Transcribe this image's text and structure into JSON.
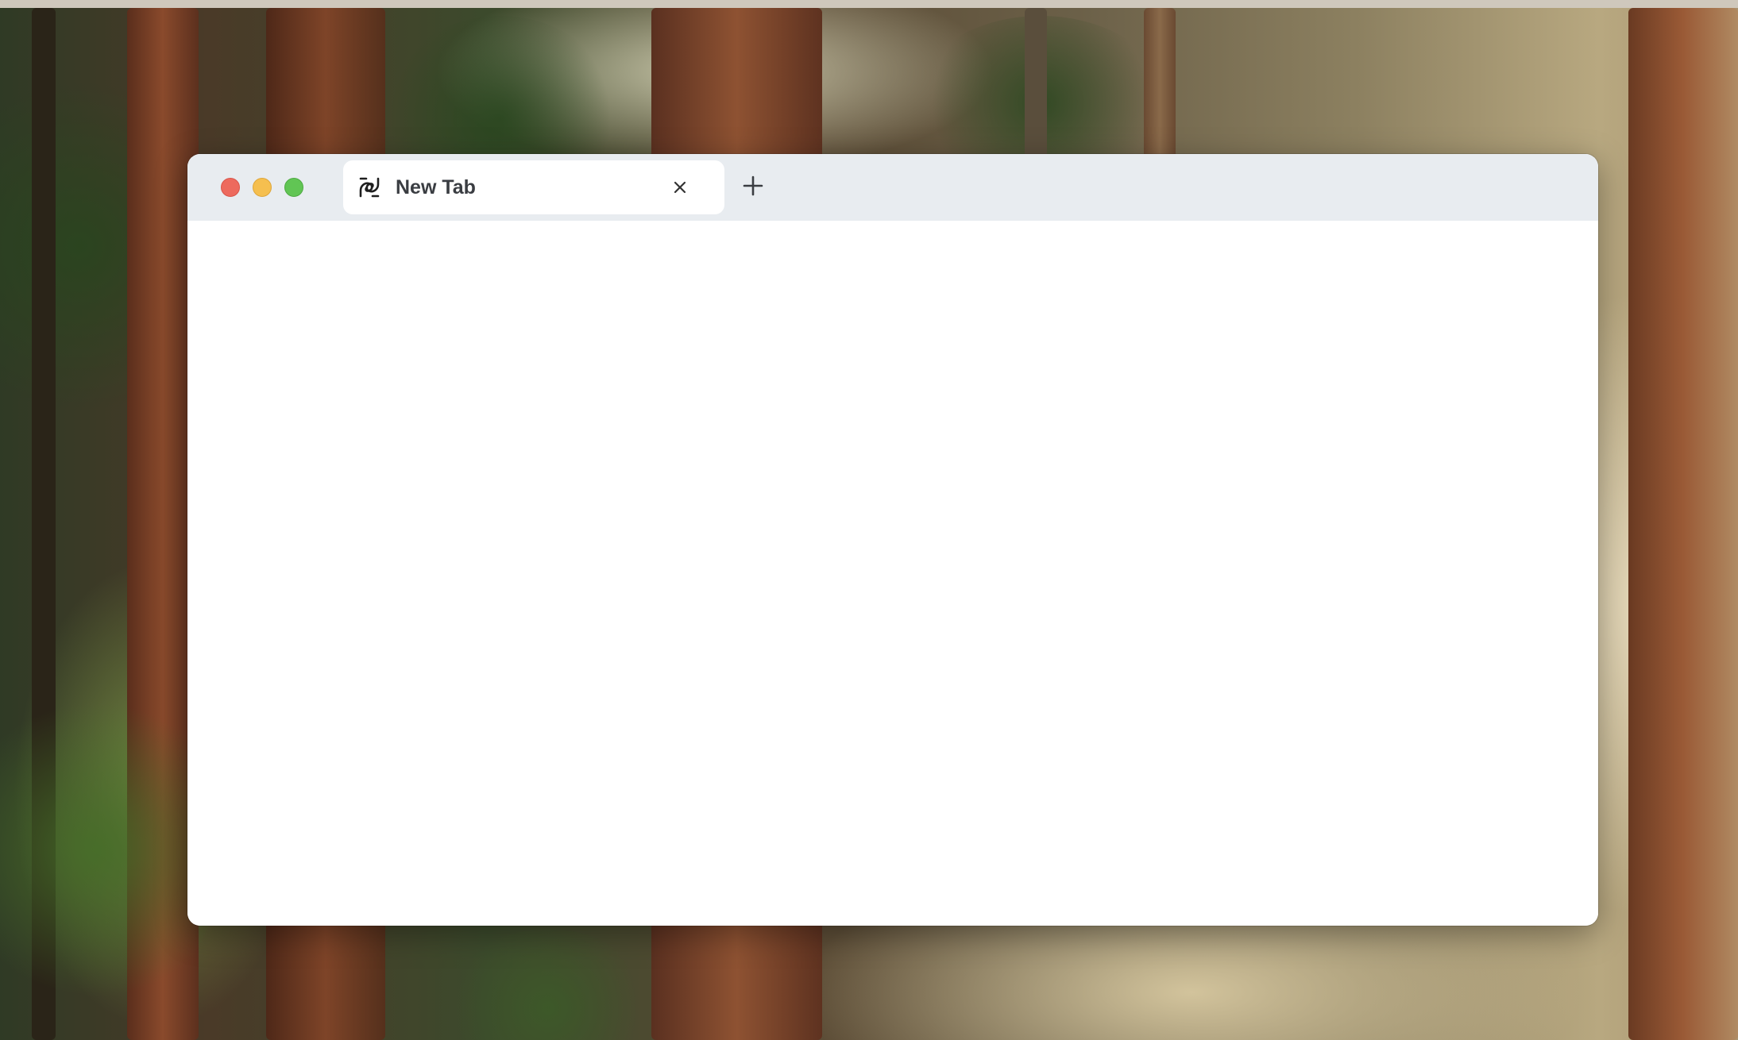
{
  "window": {
    "traffic_lights": {
      "close_color": "#ed6a5e",
      "minimize_color": "#f5bf4f",
      "maximize_color": "#61c554"
    },
    "tabs": [
      {
        "label": "New Tab",
        "icon": "browser-logo-icon",
        "close_icon": "close-icon"
      }
    ],
    "new_tab_icon": "plus-icon"
  },
  "desktop": {
    "wallpaper": "forest"
  }
}
